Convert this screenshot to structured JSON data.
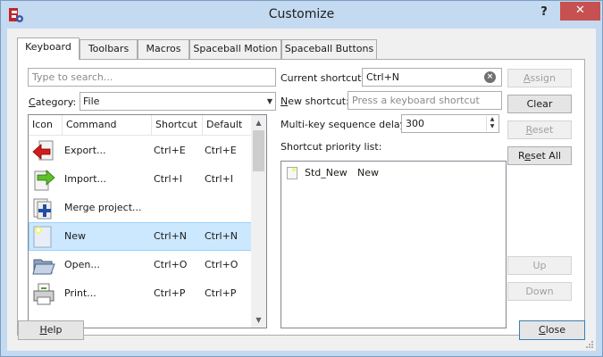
{
  "window": {
    "title": "Customize",
    "help_glyph": "?",
    "close_glyph": "✕"
  },
  "tabs": [
    {
      "label": "Keyboard",
      "active": true
    },
    {
      "label": "Toolbars",
      "active": false
    },
    {
      "label": "Macros",
      "active": false
    },
    {
      "label": "Spaceball Motion",
      "active": false
    },
    {
      "label": "Spaceball Buttons",
      "active": false
    }
  ],
  "search": {
    "placeholder": "Type to search..."
  },
  "category": {
    "label_u": "C",
    "label_rest": "ategory:",
    "value": "File"
  },
  "list": {
    "columns": [
      "Icon",
      "Command",
      "Shortcut",
      "Default"
    ],
    "rows": [
      {
        "icon": "export-icon",
        "command": "Export...",
        "shortcut": "Ctrl+E",
        "default": "Ctrl+E",
        "selected": false
      },
      {
        "icon": "import-icon",
        "command": "Import...",
        "shortcut": "Ctrl+I",
        "default": "Ctrl+I",
        "selected": false
      },
      {
        "icon": "merge-project-icon",
        "command": "Merge project...",
        "shortcut": "",
        "default": "",
        "selected": false
      },
      {
        "icon": "new-document-icon",
        "command": "New",
        "shortcut": "Ctrl+N",
        "default": "Ctrl+N",
        "selected": true
      },
      {
        "icon": "open-folder-icon",
        "command": "Open...",
        "shortcut": "Ctrl+O",
        "default": "Ctrl+O",
        "selected": false
      },
      {
        "icon": "print-icon",
        "command": "Print...",
        "shortcut": "Ctrl+P",
        "default": "Ctrl+P",
        "selected": false
      }
    ]
  },
  "current_shortcut": {
    "label": "Current shortcut:",
    "value": "Ctrl+N"
  },
  "new_shortcut": {
    "label_u": "N",
    "label_rest": "ew shortcut:",
    "placeholder": "Press a keyboard shortcut"
  },
  "delay": {
    "label": "Multi-key sequence delay:",
    "value": "300"
  },
  "priority": {
    "label": "Shortcut priority list:",
    "items": [
      {
        "name": "Std_New",
        "text": "New"
      }
    ]
  },
  "buttons": {
    "assign": {
      "u": "A",
      "rest": "ssign"
    },
    "clear": "Clear",
    "reset": {
      "u": "R",
      "rest": "eset"
    },
    "reset_all": {
      "pre": "R",
      "u": "e",
      "rest": "set All"
    },
    "up": "Up",
    "down": "Down",
    "help": {
      "u": "H",
      "rest": "elp"
    },
    "close": {
      "u": "C",
      "rest": "lose"
    }
  }
}
